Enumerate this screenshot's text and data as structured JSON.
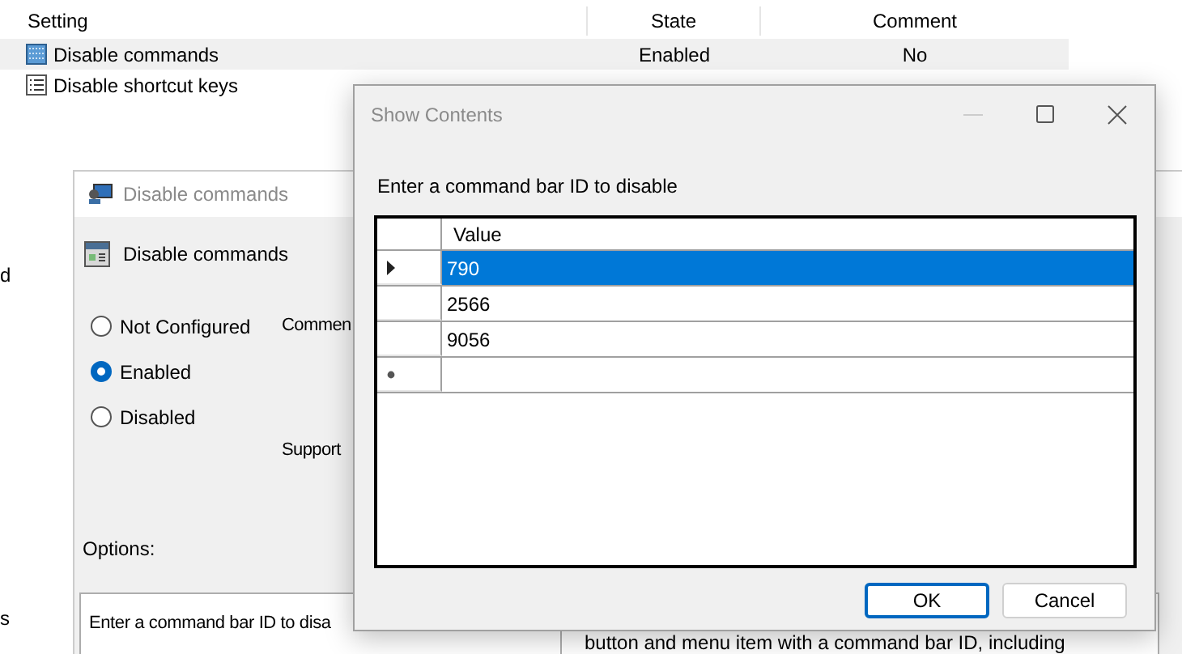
{
  "settings_list": {
    "columns": [
      "Setting",
      "State",
      "Comment"
    ],
    "rows": [
      {
        "name": "Disable commands",
        "state": "Enabled",
        "comment": "No",
        "selected": true,
        "kind": "configured"
      },
      {
        "name": "Disable shortcut keys",
        "state": "",
        "comment": "",
        "selected": false,
        "kind": "plain"
      }
    ]
  },
  "left_edge_fragments": [
    "d",
    "s"
  ],
  "policy_window": {
    "title": "Disable commands",
    "heading": "Disable commands",
    "options": [
      {
        "label": "Not Configured",
        "selected": false
      },
      {
        "label": "Enabled",
        "selected": true
      },
      {
        "label": "Disabled",
        "selected": false
      }
    ],
    "comment_label": "Commen",
    "supported_label": "Support",
    "options_label": "Options:",
    "options_text": "Enter a command bar ID to disa",
    "help_text": "button and menu item with a command bar ID, including"
  },
  "dialog": {
    "title": "Show Contents",
    "prompt": "Enter a command bar ID to disable",
    "grid": {
      "column": "Value",
      "rows": [
        {
          "kind": "data",
          "value": "790",
          "selected": true
        },
        {
          "kind": "data",
          "value": "2566",
          "selected": false
        },
        {
          "kind": "data",
          "value": "9056",
          "selected": false
        },
        {
          "kind": "new",
          "value": "",
          "selected": false
        }
      ]
    },
    "buttons": [
      {
        "label": "OK",
        "default": true
      },
      {
        "label": "Cancel",
        "default": false
      }
    ]
  }
}
